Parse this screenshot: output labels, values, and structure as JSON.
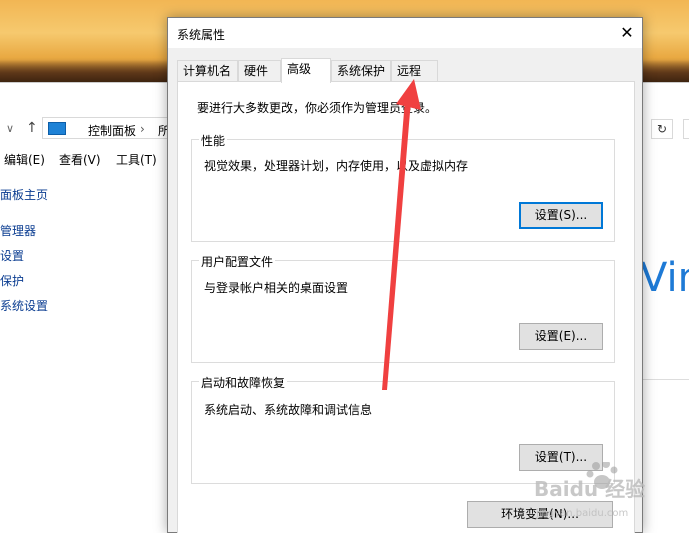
{
  "background_window": {
    "breadcrumb": "控制面板",
    "breadcrumb_cut": "所",
    "menu": [
      "编辑(E)",
      "查看(V)",
      "工具(T)"
    ],
    "sidebar": [
      "面板主页",
      "管理器",
      "设置",
      "保护",
      "系统设置"
    ],
    "content_fragments": [
      "Vin"
    ],
    "refresh_icon": "refresh-icon"
  },
  "dialog": {
    "title": "系统属性",
    "tabs": [
      {
        "label": "计算机名",
        "active": false
      },
      {
        "label": "硬件",
        "active": false
      },
      {
        "label": "高级",
        "active": true
      },
      {
        "label": "系统保护",
        "active": false
      },
      {
        "label": "远程",
        "active": false
      }
    ],
    "intro": "要进行大多数更改，你必须作为管理员登录。",
    "groups": [
      {
        "legend": "性能",
        "description": "视觉效果，处理器计划，内存使用，以及虚拟内存",
        "button": "设置(S)..."
      },
      {
        "legend": "用户配置文件",
        "description": "与登录帐户相关的桌面设置",
        "button": "设置(E)..."
      },
      {
        "legend": "启动和故障恢复",
        "description": "系统启动、系统故障和调试信息",
        "button": "设置(T)..."
      }
    ],
    "env_button": "环境变量(N)..."
  },
  "annotation": {
    "color": "#f04040"
  },
  "watermark": {
    "text": "Baidu 经验",
    "sub": "jingyan.baidu.com"
  }
}
